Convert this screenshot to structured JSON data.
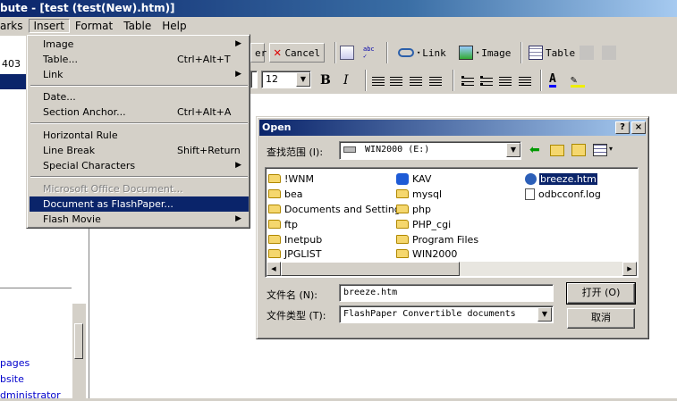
{
  "window": {
    "title": "bute - [test (test(New).htm)]"
  },
  "menubar": {
    "items": [
      "arks",
      "Insert",
      "Format",
      "Table",
      "Help"
    ]
  },
  "left_panel": {
    "top_text": "403",
    "links": [
      "pages",
      "bsite",
      "dministrator"
    ]
  },
  "toolbar": {
    "cancel_label": "Cancel",
    "partial_label": "er",
    "link_label": "Link",
    "image_label": "Image",
    "table_label": "Table",
    "font_size": "12",
    "bold": "B",
    "italic": "I"
  },
  "insert_menu": {
    "items": [
      {
        "label": "Image",
        "shortcut": "",
        "submenu": true,
        "state": "normal"
      },
      {
        "label": "Table...",
        "shortcut": "Ctrl+Alt+T",
        "submenu": false,
        "state": "normal"
      },
      {
        "label": "Link",
        "shortcut": "",
        "submenu": true,
        "state": "normal"
      },
      {
        "label": "Date...",
        "shortcut": "",
        "submenu": false,
        "state": "normal"
      },
      {
        "label": "Section Anchor...",
        "shortcut": "Ctrl+Alt+A",
        "submenu": false,
        "state": "normal"
      },
      {
        "label": "Horizontal Rule",
        "shortcut": "",
        "submenu": false,
        "state": "normal"
      },
      {
        "label": "Line Break",
        "shortcut": "Shift+Return",
        "submenu": false,
        "state": "normal"
      },
      {
        "label": "Special Characters",
        "shortcut": "",
        "submenu": true,
        "state": "normal"
      },
      {
        "label": "Microsoft Office Document...",
        "shortcut": "",
        "submenu": false,
        "state": "disabled"
      },
      {
        "label": "Document as FlashPaper...",
        "shortcut": "",
        "submenu": false,
        "state": "selected"
      },
      {
        "label": "Flash Movie",
        "shortcut": "",
        "submenu": true,
        "state": "normal"
      }
    ]
  },
  "open_dialog": {
    "title": "Open",
    "help_btn": "?",
    "close_btn": "×",
    "look_in_label": "查找范围 (I):",
    "look_in_value": "WIN2000 (E:)",
    "files_col1": [
      "!WNM",
      "bea",
      "Documents and Settings",
      "ftp",
      "Inetpub",
      "JPGLIST"
    ],
    "files_col2": [
      "KAV",
      "mysql",
      "php",
      "PHP_cgi",
      "Program Files",
      "WIN2000"
    ],
    "files_col3": [
      "breeze.htm",
      "odbcconf.log"
    ],
    "filename_label": "文件名 (N):",
    "filename_value": "breeze.htm",
    "filetype_label": "文件类型 (T):",
    "filetype_value": "FlashPaper Convertible documents",
    "open_button": "打开 (O)",
    "cancel_button": "取消"
  }
}
